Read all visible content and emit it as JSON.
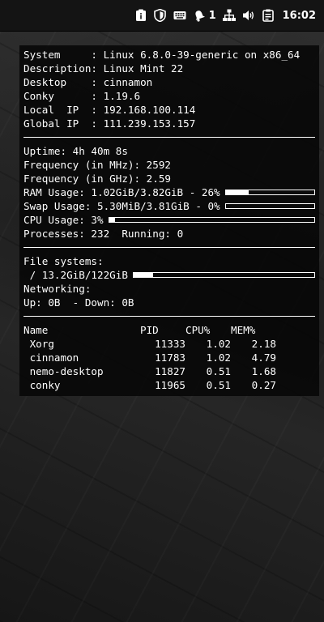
{
  "panel": {
    "notification_count": "1",
    "clock": "16:02"
  },
  "conky": {
    "system": [
      {
        "label": "System     : ",
        "value": "Linux 6.8.0-39-generic on x86_64"
      },
      {
        "label": "Description: ",
        "value": "Linux Mint 22"
      },
      {
        "label": "Desktop    : ",
        "value": "cinnamon"
      },
      {
        "label": "Conky      : ",
        "value": "1.19.6"
      },
      {
        "label": "Local  IP  : ",
        "value": "192.168.100.114"
      },
      {
        "label": "Global IP  : ",
        "value": "111.239.153.157"
      }
    ],
    "uptime": {
      "label": "Uptime: ",
      "value": "4h 40m 8s"
    },
    "freq_mhz": {
      "label": "Frequency (in MHz): ",
      "value": "2592"
    },
    "freq_ghz": {
      "label": "Frequency (in GHz): ",
      "value": "2.59"
    },
    "ram": {
      "label": "RAM Usage: ",
      "value": "1.02GiB/3.82GiB - 26%",
      "fraction": 0.26
    },
    "swap": {
      "label": "Swap Usage: ",
      "value": "5.30MiB/3.81GiB - 0%",
      "fraction": 0.0
    },
    "cpu": {
      "label": "CPU Usage: ",
      "value": "3%",
      "fraction": 0.03
    },
    "processes": {
      "label": "Processes: ",
      "value": "232",
      "running_label": "  Running: ",
      "running": "0"
    },
    "filesystems_label": "File systems:",
    "root_fs": {
      "label": " / ",
      "value": "13.2GiB/122GiB",
      "fraction": 0.108
    },
    "networking_label": "Networking:",
    "net": {
      "up_label": "Up: ",
      "up": "0B",
      "down_label": "  - Down: ",
      "down": "0B"
    },
    "proc_headers": {
      "name": "Name",
      "pid": "PID",
      "cpu": "CPU%",
      "mem": "MEM%"
    },
    "procs": [
      {
        "name": " Xorg",
        "pid": "11333",
        "cpu": "1.02",
        "mem": "2.18"
      },
      {
        "name": " cinnamon",
        "pid": "11783",
        "cpu": "1.02",
        "mem": "4.79"
      },
      {
        "name": " nemo-desktop",
        "pid": "11827",
        "cpu": "0.51",
        "mem": "1.68"
      },
      {
        "name": " conky",
        "pid": "11965",
        "cpu": "0.51",
        "mem": "0.27"
      }
    ]
  }
}
